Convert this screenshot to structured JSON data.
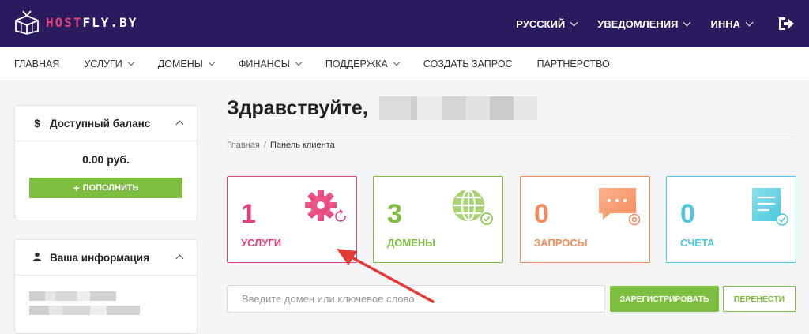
{
  "brand": {
    "host": "HOST",
    "fly": "FLY.BY",
    "accent": "#e43f76",
    "header_bg": "#2a1b5e"
  },
  "top_menu": {
    "language": "РУССКИЙ",
    "notifications": "УВЕДОМЛЕНИЯ",
    "user": "ИННА",
    "logout_icon": "logout-icon"
  },
  "nav": {
    "items": [
      {
        "label": "ГЛАВНАЯ",
        "dropdown": false
      },
      {
        "label": "УСЛУГИ",
        "dropdown": true
      },
      {
        "label": "ДОМЕНЫ",
        "dropdown": true
      },
      {
        "label": "ФИНАНСЫ",
        "dropdown": true
      },
      {
        "label": "ПОДДЕРЖКА",
        "dropdown": true
      },
      {
        "label": "СОЗДАТЬ ЗАПРОС",
        "dropdown": false
      },
      {
        "label": "ПАРТНЕРСТВО",
        "dropdown": false
      }
    ]
  },
  "sidebar": {
    "balance": {
      "icon": "$",
      "title": "Доступный баланс",
      "amount": "0.00 руб.",
      "topup_label": "ПОПОЛНИТЬ"
    },
    "info": {
      "title": "Ваша информация"
    }
  },
  "main": {
    "greeting": "Здравствуйте,",
    "breadcrumb": {
      "home": "Главная",
      "separator": "/",
      "current": "Панель клиента"
    },
    "cards": [
      {
        "count": "1",
        "label": "УСЛУГИ",
        "color": "#e43f76",
        "icon": "gear-icon"
      },
      {
        "count": "3",
        "label": "ДОМЕНЫ",
        "color": "#7dbd3f",
        "icon": "globe-icon"
      },
      {
        "count": "0",
        "label": "ЗАПРОСЫ",
        "color": "#f58a5b",
        "icon": "chat-icon"
      },
      {
        "count": "0",
        "label": "СЧЕТА",
        "color": "#4bc8dd",
        "icon": "invoice-icon"
      }
    ],
    "domain_search": {
      "placeholder": "Введите домен или ключевое слово",
      "register_label": "ЗАРЕГИСТРИРОВАТЬ",
      "transfer_label": "ПЕРЕНЕСТИ"
    }
  }
}
